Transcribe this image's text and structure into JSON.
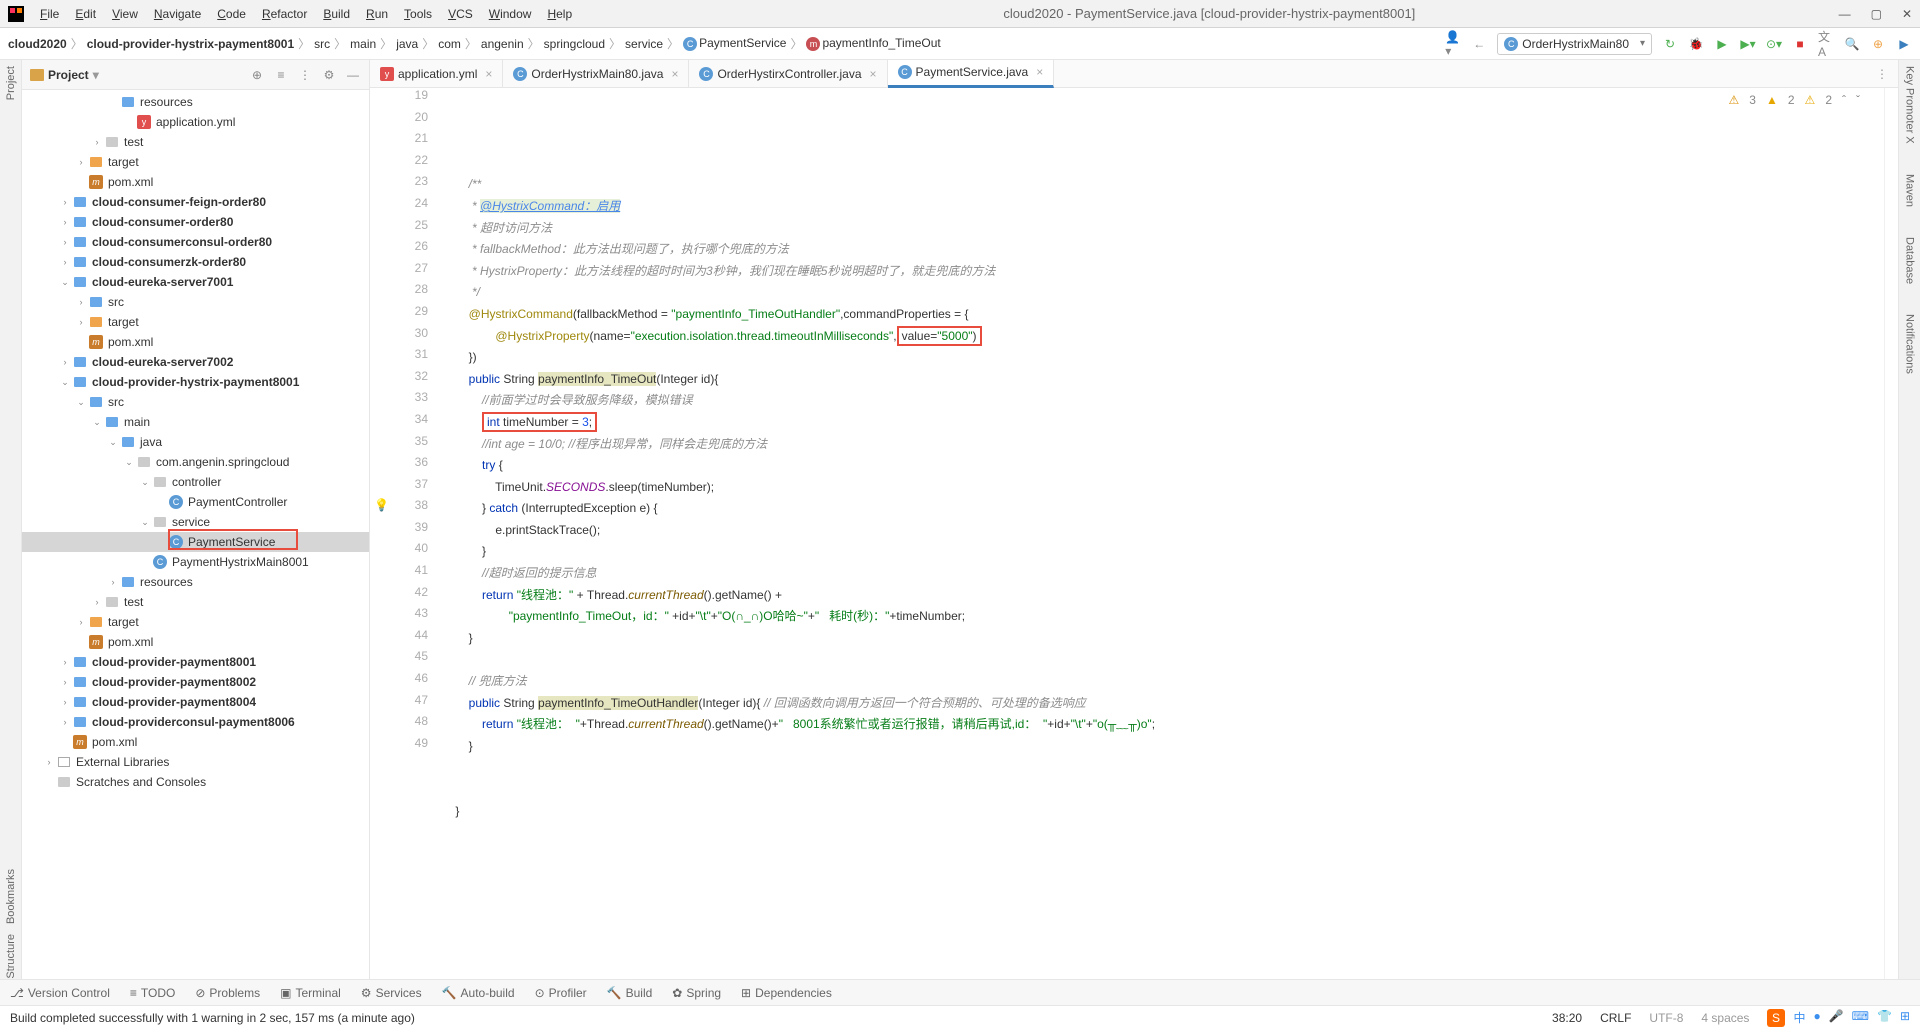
{
  "menu": [
    "File",
    "Edit",
    "View",
    "Navigate",
    "Code",
    "Refactor",
    "Build",
    "Run",
    "Tools",
    "VCS",
    "Window",
    "Help"
  ],
  "window_title": "cloud2020 - PaymentService.java [cloud-provider-hystrix-payment8001]",
  "breadcrumb": [
    "cloud2020",
    "cloud-provider-hystrix-payment8001",
    "src",
    "main",
    "java",
    "com",
    "angenin",
    "springcloud",
    "service",
    "PaymentService",
    "paymentInfo_TimeOut"
  ],
  "run_config": "OrderHystrixMain80",
  "project": {
    "title": "Project",
    "rows": [
      {
        "indent": 4,
        "chev": "",
        "icon": "dir-blue",
        "label": "resources"
      },
      {
        "indent": 5,
        "chev": "",
        "icon": "yml",
        "label": "application.yml"
      },
      {
        "indent": 3,
        "chev": "›",
        "icon": "dir",
        "label": "test"
      },
      {
        "indent": 2,
        "chev": "›",
        "icon": "dir-orange",
        "label": "target"
      },
      {
        "indent": 2,
        "chev": "",
        "icon": "m",
        "label": "pom.xml"
      },
      {
        "indent": 1,
        "chev": "›",
        "icon": "dir-blue",
        "label": "cloud-consumer-feign-order80",
        "bold": true
      },
      {
        "indent": 1,
        "chev": "›",
        "icon": "dir-blue",
        "label": "cloud-consumer-order80",
        "bold": true
      },
      {
        "indent": 1,
        "chev": "›",
        "icon": "dir-blue",
        "label": "cloud-consumerconsul-order80",
        "bold": true
      },
      {
        "indent": 1,
        "chev": "›",
        "icon": "dir-blue",
        "label": "cloud-consumerzk-order80",
        "bold": true
      },
      {
        "indent": 1,
        "chev": "⌄",
        "icon": "dir-blue",
        "label": "cloud-eureka-server7001",
        "bold": true
      },
      {
        "indent": 2,
        "chev": "›",
        "icon": "dir-blue",
        "label": "src"
      },
      {
        "indent": 2,
        "chev": "›",
        "icon": "dir-orange",
        "label": "target"
      },
      {
        "indent": 2,
        "chev": "",
        "icon": "m",
        "label": "pom.xml"
      },
      {
        "indent": 1,
        "chev": "›",
        "icon": "dir-blue",
        "label": "cloud-eureka-server7002",
        "bold": true
      },
      {
        "indent": 1,
        "chev": "⌄",
        "icon": "dir-blue",
        "label": "cloud-provider-hystrix-payment8001",
        "bold": true
      },
      {
        "indent": 2,
        "chev": "⌄",
        "icon": "dir-blue",
        "label": "src"
      },
      {
        "indent": 3,
        "chev": "⌄",
        "icon": "dir-blue",
        "label": "main"
      },
      {
        "indent": 4,
        "chev": "⌄",
        "icon": "dir-blue",
        "label": "java"
      },
      {
        "indent": 5,
        "chev": "⌄",
        "icon": "dir",
        "label": "com.angenin.springcloud"
      },
      {
        "indent": 6,
        "chev": "⌄",
        "icon": "dir",
        "label": "controller"
      },
      {
        "indent": 7,
        "chev": "",
        "icon": "c",
        "label": "PaymentController"
      },
      {
        "indent": 6,
        "chev": "⌄",
        "icon": "dir",
        "label": "service"
      },
      {
        "indent": 7,
        "chev": "",
        "icon": "c",
        "label": "PaymentService",
        "selected": true
      },
      {
        "indent": 6,
        "chev": "",
        "icon": "c",
        "label": "PaymentHystrixMain8001"
      },
      {
        "indent": 4,
        "chev": "›",
        "icon": "dir-blue",
        "label": "resources"
      },
      {
        "indent": 3,
        "chev": "›",
        "icon": "dir",
        "label": "test"
      },
      {
        "indent": 2,
        "chev": "›",
        "icon": "dir-orange",
        "label": "target"
      },
      {
        "indent": 2,
        "chev": "",
        "icon": "m",
        "label": "pom.xml"
      },
      {
        "indent": 1,
        "chev": "›",
        "icon": "dir-blue",
        "label": "cloud-provider-payment8001",
        "bold": true
      },
      {
        "indent": 1,
        "chev": "›",
        "icon": "dir-blue",
        "label": "cloud-provider-payment8002",
        "bold": true
      },
      {
        "indent": 1,
        "chev": "›",
        "icon": "dir-blue",
        "label": "cloud-provider-payment8004",
        "bold": true
      },
      {
        "indent": 1,
        "chev": "›",
        "icon": "dir-blue",
        "label": "cloud-providerconsul-payment8006",
        "bold": true
      },
      {
        "indent": 1,
        "chev": "",
        "icon": "m",
        "label": "pom.xml"
      },
      {
        "indent": 0,
        "chev": "›",
        "icon": "lib",
        "label": "External Libraries"
      },
      {
        "indent": 0,
        "chev": "",
        "icon": "dir",
        "label": "Scratches and Consoles"
      }
    ]
  },
  "tabs": [
    {
      "label": "application.yml",
      "icon": "yml"
    },
    {
      "label": "OrderHystrixMain80.java",
      "icon": "c"
    },
    {
      "label": "OrderHystirxController.java",
      "icon": "c"
    },
    {
      "label": "PaymentService.java",
      "icon": "c",
      "active": true
    }
  ],
  "code_start": 19,
  "code_lines": [
    "",
    "        <span class='doc'>/**</span>",
    "        <span class='doc'> * </span><span class='link'>@HystrixCommand：启用</span>",
    "        <span class='doc'> * 超时访问方法</span>",
    "        <span class='doc'> * fallbackMethod：此方法出现问题了，执行哪个兜底的方法</span>",
    "        <span class='doc'> * HystrixProperty：此方法线程的超时时间为3秒钟，我们现在睡眠5秒说明超时了，就走兜底的方法</span>",
    "        <span class='doc'> */</span>",
    "        <span class='ann'>@HystrixCommand</span>(fallbackMethod = <span class='str'>\"paymentInfo_TimeOutHandler\"</span>,commandProperties = {",
    "                <span class='ann'>@HystrixProperty</span>(name=<span class='str'>\"execution.isolation.thread.timeoutInMilliseconds\"</span>,<span class='redbox'>value=<span class='str'>\"5000\"</span>)</span>",
    "        })",
    "        <span class='kw'>public</span> String <span class='hlname'>paymentInfo_TimeOut</span>(Integer id){",
    "            <span class='cmt'>//前面学过时会导致服务降级，模拟错误</span>",
    "            <span class='redbox'><span class='kw'>int</span> timeNumber = <span class='num'>3</span>;</span>",
    "            <span class='cmt'>//int age = 10/0; //程序出现异常，同样会走兜底的方法</span>",
    "            <span class='kw'>try</span> {",
    "                TimeUnit.<span class='fn' style='font-style:italic;color:#871094'>SECONDS</span>.sleep(timeNumber);",
    "            } <span class='kw'>catch</span> (InterruptedException e) {",
    "                e.printStackTrace();",
    "            }",
    "            <span class='cmt'>//超时返回的提示信息</span>",
    "            <span class='kw'>return</span> <span class='str'>\"线程池：\"</span> + Thread.<span class='fn'>currentThread</span>().getName() +",
    "                    <span class='str'>\"paymentInfo_TimeOut，id：\"</span> +id+<span class='str'>\"\\t\"</span>+<span class='str'>\"O(∩_∩)O哈哈~\"</span>+<span class='str'>\"   耗时(秒)：\"</span>+timeNumber;",
    "        }",
    "",
    "        <span class='cmt'>// 兜底方法</span>",
    "        <span class='kw'>public</span> String <span class='hlname'>paymentInfo_TimeOutHandler</span>(Integer id){ <span class='cmt'>// 回调函数向调用方返回一个符合预期的、可处理的备选响应</span>",
    "            <span class='kw'>return</span> <span class='str'>\"线程池：  \"</span>+Thread.<span class='fn'>currentThread</span>().getName()+<span class='str'>\"   8001系统繁忙或者运行报错，请稍后再试,id：  \"</span>+id+<span class='str'>\"\\t\"</span>+<span class='str'>\"o(╥﹏╥)o\"</span>;",
    "        }",
    "",
    "",
    "    }"
  ],
  "inspections": {
    "err": "3",
    "warn1": "2",
    "warn2": "2"
  },
  "bottom_panels": [
    "Version Control",
    "TODO",
    "Problems",
    "Terminal",
    "Services",
    "Auto-build",
    "Profiler",
    "Build",
    "Spring",
    "Dependencies"
  ],
  "status_msg": "Build completed successfully with 1 warning in 2 sec, 157 ms (a minute ago)",
  "caret": "38:20",
  "eol": "CRLF",
  "encoding": "UTF-8",
  "indent": "4 spaces",
  "left_tools": [
    "Project",
    "Bookmarks",
    "Structure"
  ],
  "right_tools": [
    "Key Promoter X",
    "Maven",
    "Database",
    "Notifications"
  ]
}
